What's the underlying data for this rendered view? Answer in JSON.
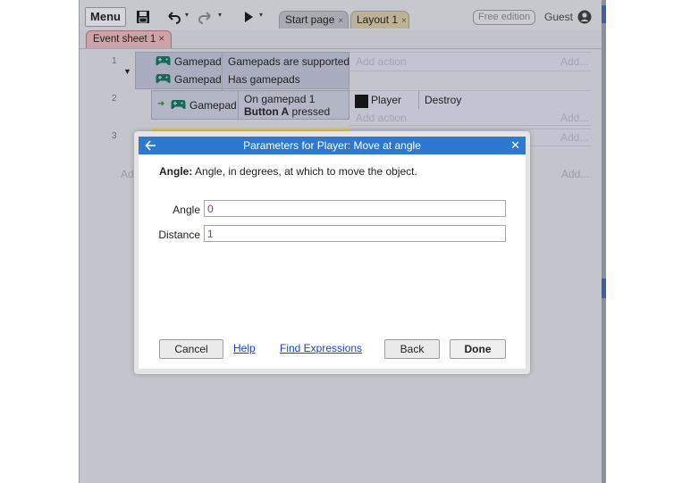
{
  "toolbar": {
    "menu_label": "Menu",
    "tabs": [
      {
        "label": "Start page",
        "close": "×"
      },
      {
        "label": "Layout 1",
        "close": "×"
      }
    ],
    "edition_badge": "Free edition",
    "user": "Guest"
  },
  "sheet_tab": {
    "label": "Event sheet 1",
    "close": "×"
  },
  "events": [
    {
      "number": "1",
      "conditions": [
        {
          "object": "Gamepad",
          "text": "Gamepads are supported"
        },
        {
          "object": "Gamepad",
          "text": "Has gamepads"
        }
      ],
      "add_action": "Add action",
      "add_more": "Add..."
    },
    {
      "number": "2",
      "conditions": [
        {
          "object": "Gamepad",
          "text_prefix": "On gamepad 1 ",
          "text_bold": "Button A",
          "text_suffix": " pressed"
        }
      ],
      "actions": [
        {
          "object": "Player",
          "text": "Destroy"
        }
      ],
      "add_action": "Add action",
      "add_more": "Add..."
    },
    {
      "number": "3",
      "add_more": "Add..."
    }
  ],
  "sheet_add_left": "Ad",
  "sheet_add_right": "Add...",
  "dialog": {
    "title": "Parameters for Player: Move at angle",
    "description_bold": "Angle:",
    "description": " Angle, in degrees, at which to move the object.",
    "params": [
      {
        "label": "Angle",
        "value": "0"
      },
      {
        "label": "Distance",
        "value": "1"
      }
    ],
    "buttons": {
      "cancel": "Cancel",
      "help": "Help",
      "find_expressions": "Find Expressions",
      "back": "Back",
      "done": "Done"
    }
  },
  "colors": {
    "dialog_title_bg": "#2e79cf",
    "param_value_text": "#8b3aa6",
    "link": "#1a44c8",
    "layout_tab": "#bdb394",
    "event_sheet_tab": "#cba3a8"
  },
  "icons": [
    "save-icon",
    "undo-icon",
    "redo-icon",
    "play-icon",
    "user-icon",
    "gamepad-icon",
    "back-arrow-icon",
    "close-icon"
  ]
}
